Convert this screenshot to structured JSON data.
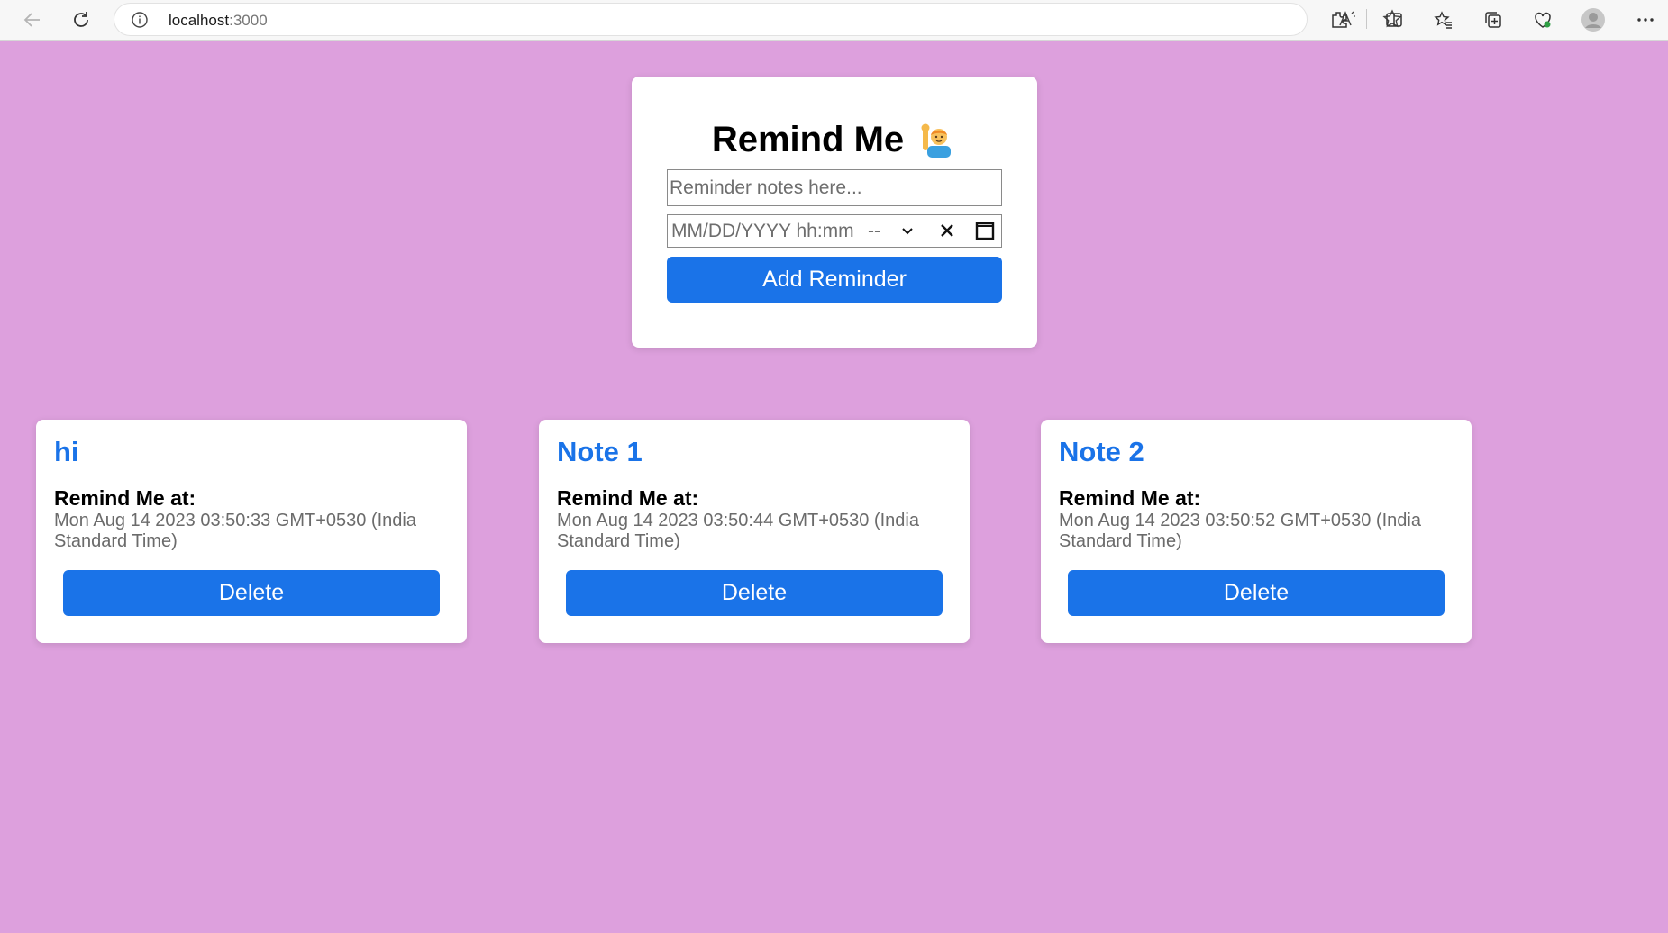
{
  "browser": {
    "url_host": "localhost",
    "url_port": ":3000"
  },
  "form": {
    "title": "Remind Me",
    "title_emoji": "🙋‍♂️",
    "note_placeholder": "Reminder notes here...",
    "datetime_placeholder": "MM/DD/YYYY  hh:mm",
    "datetime_ampm": "--",
    "add_button_label": "Add Reminder"
  },
  "reminders": [
    {
      "title": "hi",
      "label": "Remind Me at:",
      "date": "Mon Aug 14 2023 03:50:33 GMT+0530 (India Standard Time)",
      "delete_label": "Delete"
    },
    {
      "title": "Note 1",
      "label": "Remind Me at:",
      "date": "Mon Aug 14 2023 03:50:44 GMT+0530 (India Standard Time)",
      "delete_label": "Delete"
    },
    {
      "title": "Note 2",
      "label": "Remind Me at:",
      "date": "Mon Aug 14 2023 03:50:52 GMT+0530 (India Standard Time)",
      "delete_label": "Delete"
    }
  ],
  "colors": {
    "background": "#dda0dd",
    "accent": "#1a73e8",
    "card": "#ffffff"
  }
}
